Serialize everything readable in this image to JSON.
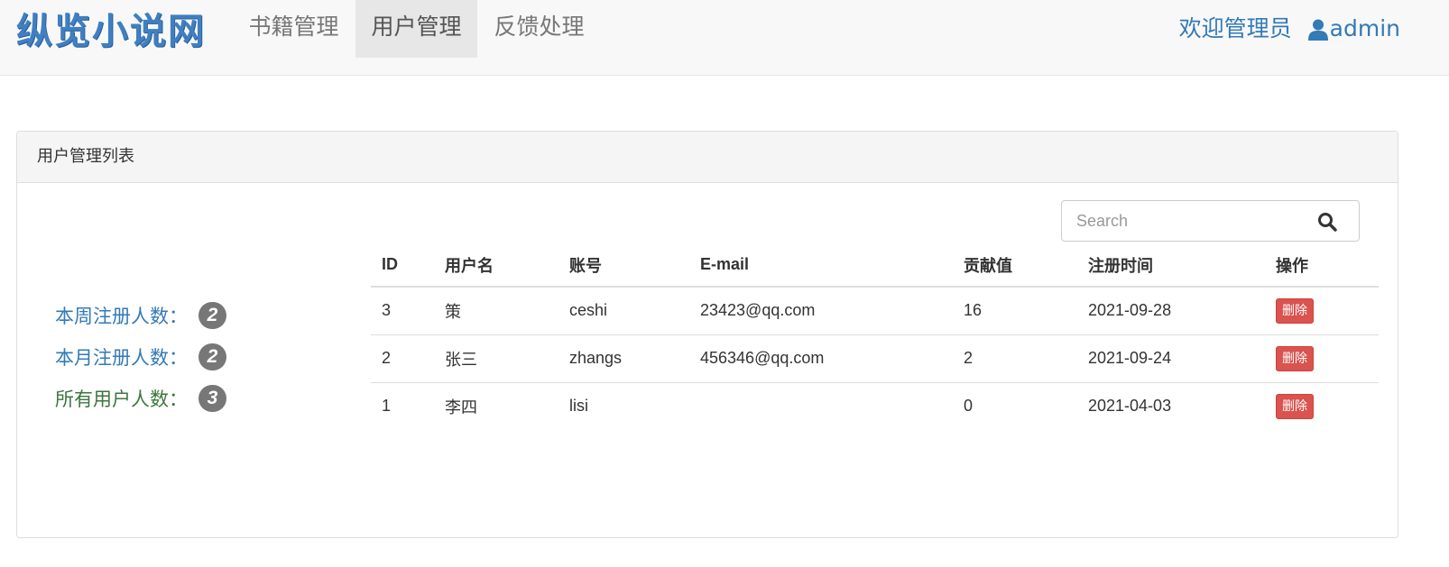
{
  "navbar": {
    "brand": "纵览小说网",
    "items": [
      {
        "label": "书籍管理",
        "active": false
      },
      {
        "label": "用户管理",
        "active": true
      },
      {
        "label": "反馈处理",
        "active": false
      }
    ],
    "welcome_text": "欢迎管理员",
    "user_icon": "user-icon",
    "username": "admin"
  },
  "panel": {
    "heading": "用户管理列表",
    "stats": [
      {
        "label": "本周注册人数：",
        "count": "2"
      },
      {
        "label": "本月注册人数：",
        "count": "2"
      },
      {
        "label": "所有用户人数：",
        "count": "3"
      }
    ],
    "search": {
      "placeholder": "Search",
      "icon": "search-icon"
    },
    "table": {
      "columns": [
        "ID",
        "用户名",
        "账号",
        "E-mail",
        "贡献值",
        "注册时间",
        "操作"
      ],
      "rows": [
        {
          "id": "3",
          "name": "策",
          "account": "ceshi",
          "email": "23423@qq.com",
          "points": "16",
          "date": "2021-09-28",
          "action": "删除"
        },
        {
          "id": "2",
          "name": "张三",
          "account": "zhangs",
          "email": "456346@qq.com",
          "points": "2",
          "date": "2021-09-24",
          "action": "删除"
        },
        {
          "id": "1",
          "name": "李四",
          "account": "lisi",
          "email": "",
          "points": "0",
          "date": "2021-04-03",
          "action": "删除"
        }
      ]
    }
  },
  "colors": {
    "link": "#337ab7",
    "success": "#3c763d",
    "danger": "#d9534f",
    "badge": "#777777"
  }
}
